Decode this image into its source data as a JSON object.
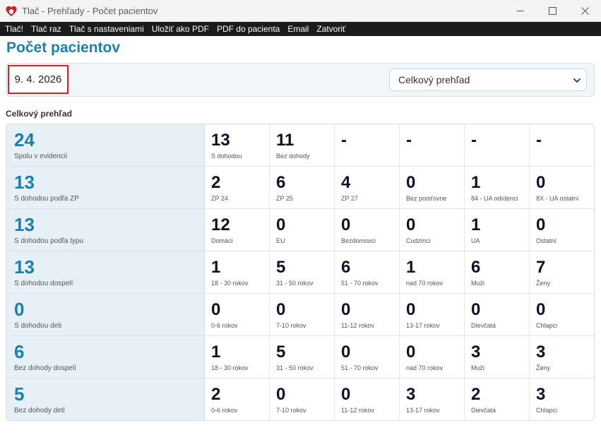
{
  "window": {
    "title": "Tlač - Prehľady - Počet pacientov",
    "app_icon": "heart-shield-icon",
    "brand_color": "#c9242b",
    "controls": [
      "minimize-icon",
      "maximize-icon",
      "close-icon"
    ]
  },
  "menu": [
    "Tlač!",
    "Tlač raz",
    "Tlač s nastaveniami",
    "Uložiť ako PDF",
    "PDF do pacienta",
    "Email",
    "Zatvoriť"
  ],
  "page_title": "Počet pacientov",
  "filter": {
    "date": "9. 4. 2026",
    "date_highlight_color": "#e41e1e",
    "view_selected": "Celkový prehľad"
  },
  "section_title": "Celkový prehľad",
  "colors": {
    "accent": "#1d7fae",
    "main_cell_bg": "#e6f0f6",
    "value_text": "#0d1226"
  },
  "rows": [
    {
      "value": "24",
      "label": "Spolu v evidencii",
      "cells": [
        {
          "value": "13",
          "label": "S dohodou"
        },
        {
          "value": "11",
          "label": "Bez dohody"
        },
        {
          "value": "-",
          "label": ""
        },
        {
          "value": "-",
          "label": ""
        },
        {
          "value": "-",
          "label": ""
        },
        {
          "value": "-",
          "label": ""
        }
      ]
    },
    {
      "value": "13",
      "label": "S dohodou podľa ZP",
      "cells": [
        {
          "value": "2",
          "label": "ZP 24"
        },
        {
          "value": "6",
          "label": "ZP 25"
        },
        {
          "value": "4",
          "label": "ZP 27"
        },
        {
          "value": "0",
          "label": "Bez poisťovne"
        },
        {
          "value": "1",
          "label": "84 - UA odídenci"
        },
        {
          "value": "0",
          "label": "8X - UA ostatní"
        }
      ]
    },
    {
      "value": "13",
      "label": "S dohodou podľa typu",
      "cells": [
        {
          "value": "12",
          "label": "Domáci"
        },
        {
          "value": "0",
          "label": "EU"
        },
        {
          "value": "0",
          "label": "Bezdomovci"
        },
        {
          "value": "0",
          "label": "Cudzinci"
        },
        {
          "value": "1",
          "label": "UA"
        },
        {
          "value": "0",
          "label": "Ostatní"
        }
      ]
    },
    {
      "value": "13",
      "label": "S dohodou dospelí",
      "cells": [
        {
          "value": "1",
          "label": "18 - 30 rokov"
        },
        {
          "value": "5",
          "label": "31 - 50 rokov"
        },
        {
          "value": "6",
          "label": "51 - 70 rokov"
        },
        {
          "value": "1",
          "label": "nad 70 rokov"
        },
        {
          "value": "6",
          "label": "Muži"
        },
        {
          "value": "7",
          "label": "Ženy"
        }
      ]
    },
    {
      "value": "0",
      "label": "S dohodou deti",
      "cells": [
        {
          "value": "0",
          "label": "0-6 rokov"
        },
        {
          "value": "0",
          "label": "7-10 rokov"
        },
        {
          "value": "0",
          "label": "11-12 rokov"
        },
        {
          "value": "0",
          "label": "13-17 rokov"
        },
        {
          "value": "0",
          "label": "Dievčatá"
        },
        {
          "value": "0",
          "label": "Chlapci"
        }
      ]
    },
    {
      "value": "6",
      "label": "Bez dohody dospelí",
      "cells": [
        {
          "value": "1",
          "label": "18 - 30 rokov"
        },
        {
          "value": "5",
          "label": "31 - 50 rokov"
        },
        {
          "value": "0",
          "label": "51 - 70 rokov"
        },
        {
          "value": "0",
          "label": "nad 70 rokov"
        },
        {
          "value": "3",
          "label": "Muži"
        },
        {
          "value": "3",
          "label": "Ženy"
        }
      ]
    },
    {
      "value": "5",
      "label": "Bez dohody deti",
      "cells": [
        {
          "value": "2",
          "label": "0-6 rokov"
        },
        {
          "value": "0",
          "label": "7-10 rokov"
        },
        {
          "value": "0",
          "label": "11-12 rokov"
        },
        {
          "value": "3",
          "label": "13-17 rokov"
        },
        {
          "value": "2",
          "label": "Dievčatá"
        },
        {
          "value": "3",
          "label": "Chlapci"
        }
      ]
    }
  ]
}
